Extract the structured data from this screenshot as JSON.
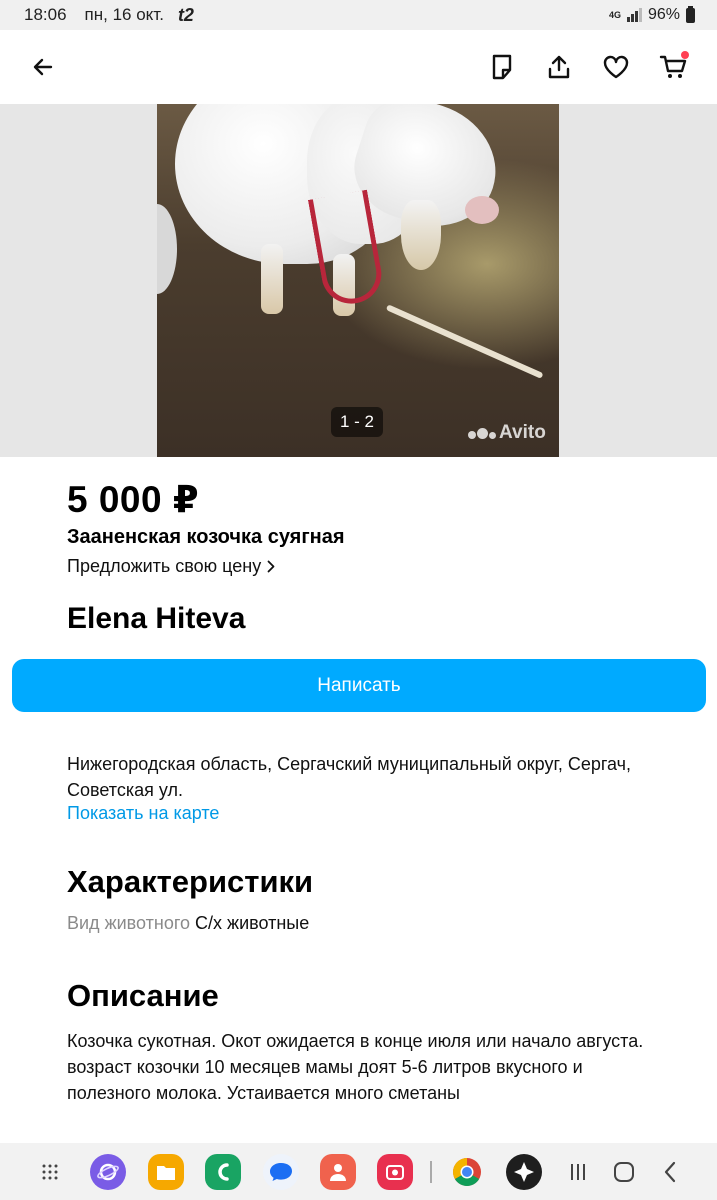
{
  "status_bar": {
    "time": "18:06",
    "date": "пн, 16 окт.",
    "carrier": "t2",
    "network": "4G",
    "battery": "96%"
  },
  "app_bar": {
    "icons": [
      "back-arrow-icon",
      "note-icon",
      "share-icon",
      "heart-icon",
      "cart-icon"
    ],
    "cart_has_badge": true
  },
  "gallery": {
    "counter": "1 - 2",
    "watermark": "Avito",
    "current": 1,
    "total": 2
  },
  "listing": {
    "price": "5 000 ₽",
    "title": "Зааненская козочка суягная",
    "offer_price": "Предложить свою цену"
  },
  "seller": {
    "name": "Elena Hiteva",
    "write_button": "Написать"
  },
  "location": {
    "address": "Нижегородская область, Сергачский муниципальный округ, Сергач, Советская ул.",
    "map_link": "Показать на карте"
  },
  "characteristics": {
    "heading": "Характеристики",
    "items": [
      {
        "key": "Вид животного",
        "value": "С/х животные"
      }
    ]
  },
  "description": {
    "heading": "Описание",
    "text": "Козочка сукотная. Окот ожидается в конце июля или начало августа. возраст козочки 10 месяцев мамы доят 5-6 литров вкусного и полезного молока. Устаивается много сметаны"
  },
  "taskbar": {
    "apps": [
      "apps-grid-icon",
      "samsung-internet-icon",
      "my-files-icon",
      "phone-icon",
      "messages-icon",
      "contacts-icon",
      "screen-recorder-icon",
      "chrome-icon",
      "camera-aperture-icon"
    ],
    "nav": [
      "recents-icon",
      "home-icon",
      "back-icon"
    ]
  },
  "colors": {
    "accent": "#00aaff",
    "link": "#0099e6",
    "badge": "#ff4053",
    "muted_text": "#8a8a8a"
  }
}
